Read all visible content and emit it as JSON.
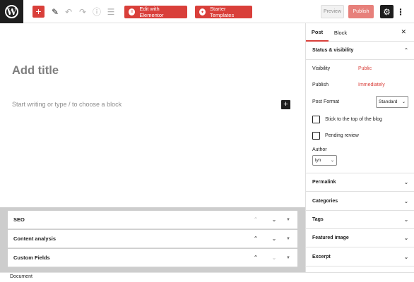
{
  "toolbar": {
    "logo_glyph": "W",
    "add_glyph": "+",
    "edit_glyph": "✎",
    "undo_glyph": "↶",
    "redo_glyph": "↷",
    "info_glyph": "ⓘ",
    "outline_glyph": "☰",
    "elementor_label": "Edit with Elementor",
    "elementor_glyph": "≡",
    "starter_label": "Starter Templates",
    "starter_glyph": "✦",
    "preview_label": "Preview",
    "publish_label": "Publish",
    "settings_glyph": "⚙",
    "more_glyph": "⋮",
    "accent_color": "#d93f3a"
  },
  "editor": {
    "title_placeholder": "Add title",
    "block_placeholder": "Start writing or type / to choose a block",
    "block_add_glyph": "+"
  },
  "metaboxes": [
    {
      "title": "SEO",
      "up": "⌃",
      "down": "⌄",
      "toggle": "▼"
    },
    {
      "title": "Content analysis",
      "up": "⌃",
      "down": "⌄",
      "toggle": "▼"
    },
    {
      "title": "Custom Fields",
      "up": "⌃",
      "down": "⌄",
      "toggle": "▼"
    }
  ],
  "footer": {
    "breadcrumb": "Document"
  },
  "sidebar": {
    "tabs": [
      {
        "label": "Post"
      },
      {
        "label": "Block"
      }
    ],
    "close_glyph": "✕",
    "status_section": {
      "title": "Status & visibility",
      "collapse_glyph": "⌃",
      "visibility_label": "Visibility",
      "visibility_value": "Public",
      "publish_label": "Publish",
      "publish_value": "Immediately",
      "post_format_label": "Post Format",
      "post_format_value": "Standard",
      "sticky_label": "Stick to the top of the blog",
      "pending_label": "Pending review",
      "author_label": "Author",
      "author_value": "lyn"
    },
    "panels": [
      {
        "title": "Permalink",
        "chev": "⌄"
      },
      {
        "title": "Categories",
        "chev": "⌄"
      },
      {
        "title": "Tags",
        "chev": "⌄"
      },
      {
        "title": "Featured image",
        "chev": "⌄"
      },
      {
        "title": "Excerpt",
        "chev": "⌄"
      }
    ]
  }
}
